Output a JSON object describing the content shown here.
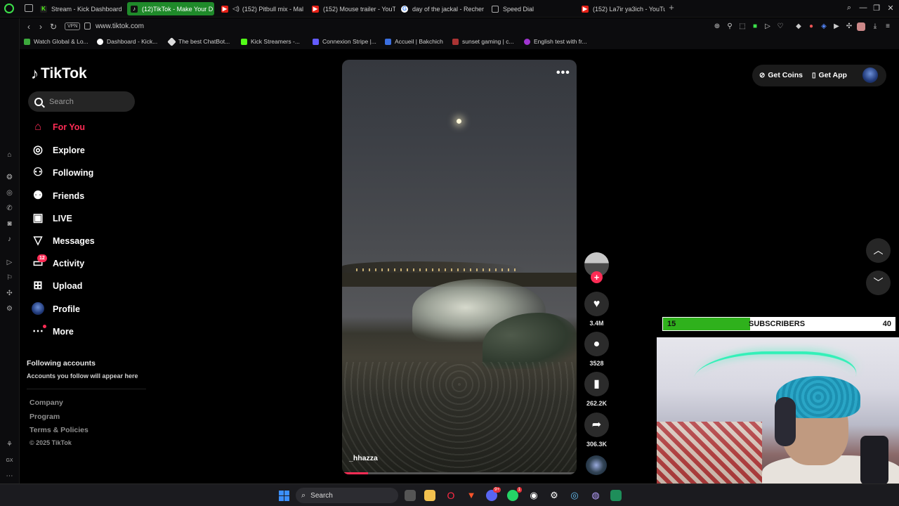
{
  "browser": {
    "tabs": [
      {
        "label": "Stream - Kick Dashboard",
        "icon": "kick-icon",
        "active": false
      },
      {
        "label": "(12)TikTok - Make Your D",
        "icon": "tiktok-icon",
        "active": true
      },
      {
        "label": "(152) Pitbull mix - Mal",
        "icon": "youtube-icon",
        "active": false
      },
      {
        "label": "(152) Mouse trailer - YouT",
        "icon": "youtube-icon",
        "active": false
      },
      {
        "label": "day of the jackal - Recher",
        "icon": "google-icon",
        "active": false
      },
      {
        "label": "Speed Dial",
        "icon": "speed-dial-icon",
        "active": false
      },
      {
        "label": "(152) La7ir ya3ich - YouTu",
        "icon": "youtube-icon",
        "active": false
      }
    ],
    "vpn_label": "VPN",
    "url": "www.tiktok.com",
    "bookmarks": [
      "Watch Global & Lo...",
      "Dashboard - Kick...",
      "The best ChatBot...",
      "Kick Streamers -...",
      "Connexion Stripe |...",
      "Accueil | Bakchich",
      "sunset gaming | c...",
      "English test with fr..."
    ]
  },
  "tiktok": {
    "logo": "TikTok",
    "search_placeholder": "Search",
    "nav": {
      "for_you": "For You",
      "explore": "Explore",
      "following": "Following",
      "friends": "Friends",
      "live": "LIVE",
      "messages": "Messages",
      "activity": "Activity",
      "activity_badge": "12",
      "upload": "Upload",
      "profile": "Profile",
      "more": "More"
    },
    "following_accounts_title": "Following accounts",
    "following_accounts_sub": "Accounts you follow will appear here",
    "footer": {
      "company": "Company",
      "program": "Program",
      "terms": "Terms & Policies",
      "copyright": "© 2025 TikTok"
    },
    "video": {
      "author": "_hhazza",
      "menu": "•••",
      "progress": 0.11
    },
    "actions": {
      "likes": "3.4M",
      "comments": "3528",
      "saves": "262.2K",
      "shares": "306.3K"
    },
    "top_right": {
      "get_coins": "Get Coins",
      "get_app": "Get App"
    }
  },
  "subscriber_goal": {
    "current": "15",
    "label": "SUBSCRIBERS",
    "goal": "40",
    "progress": 0.375
  },
  "taskbar": {
    "search_label": "Search",
    "discord_badge": "9+",
    "whatsapp_badge": "1"
  }
}
